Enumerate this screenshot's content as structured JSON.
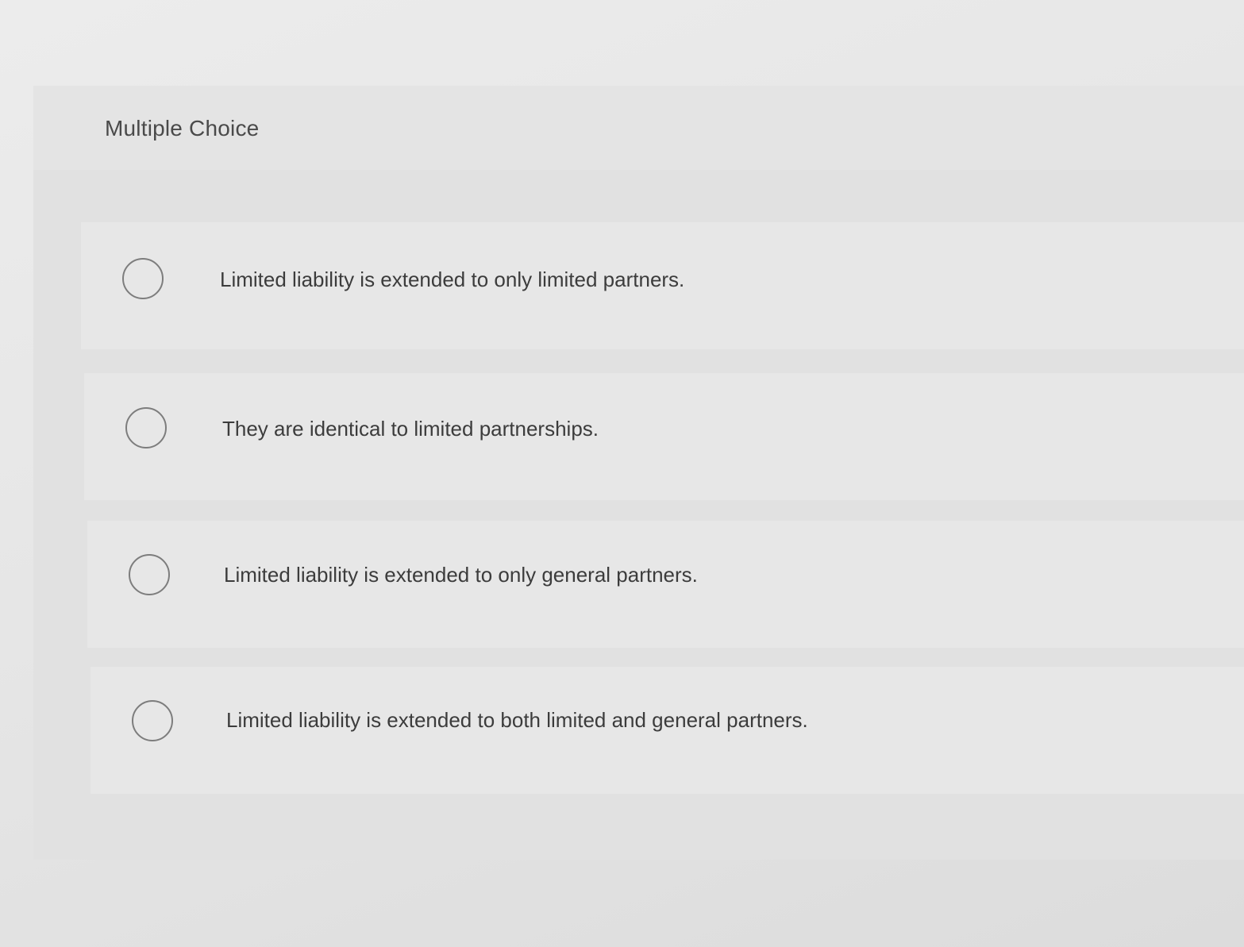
{
  "question": {
    "type_label": "Multiple Choice"
  },
  "choices": [
    {
      "label": "Limited liability is extended to only limited partners.",
      "selected": false
    },
    {
      "label": "They are identical to limited partnerships.",
      "selected": false
    },
    {
      "label": "Limited liability is extended to only general partners.",
      "selected": false
    },
    {
      "label": "Limited liability is extended to both limited and general partners.",
      "selected": false
    }
  ],
  "colors": {
    "page_background": "#e6e6e6",
    "panel_background": "#e1e1e1",
    "row_background": "#e7e7e7",
    "text": "#3c3c3c",
    "radio_border": "#7d7d7d"
  },
  "icons": {
    "radio": "radio-button-icon"
  }
}
